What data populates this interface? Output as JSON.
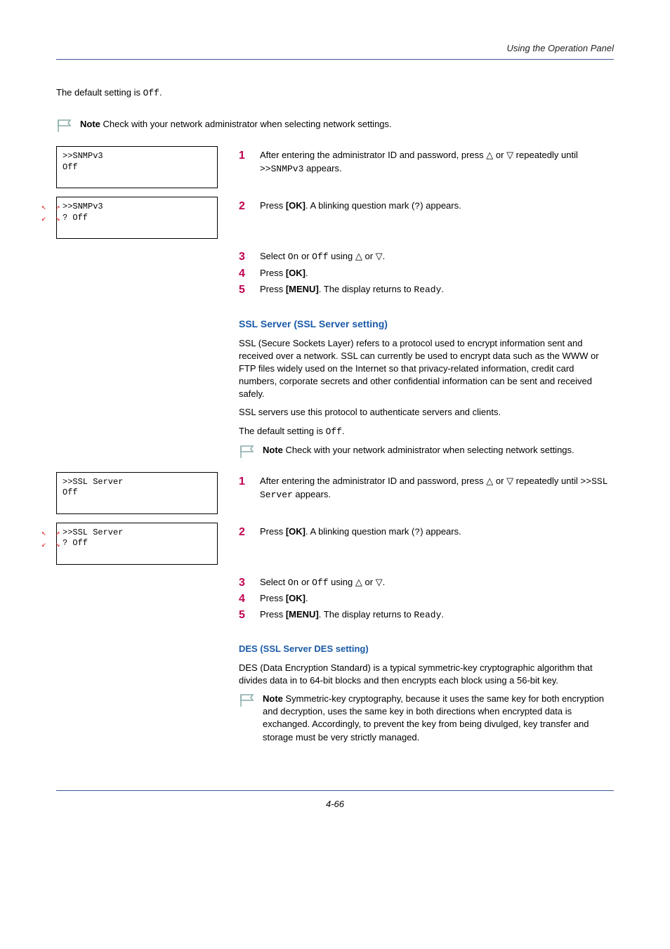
{
  "header": {
    "title": "Using the Operation Panel"
  },
  "intro": {
    "default_text": "The default setting is "
  },
  "notes": {
    "network": "Check with your network administrator when selecting network settings.",
    "symmetric": "Symmetric-key cryptography, because it uses the same key for both encryption and decryption, uses the same key in both directions when encrypted data is exchanged. Accordingly, to prevent the key from being divulged, key transfer and storage must be very strictly managed.",
    "label": "Note"
  },
  "lcd": {
    "snmpv3_line1": ">>SNMPv3",
    "snmpv3_line2": "  Off",
    "snmpv3_q_line1": ">>SNMPv3",
    "snmpv3_q_line2": "? Off",
    "ssl_line1": ">>SSL Server",
    "ssl_line2": "  Off",
    "ssl_q_line1": ">>SSL Server",
    "ssl_q_line2": "? Off"
  },
  "steps_a": {
    "s1a": "After entering the administrator ID and password, press ",
    "s1b": " or ",
    "s1c": " repeatedly until ",
    "s1d": " appears.",
    "s2a": "Press ",
    "s2b": ". A blinking question mark (",
    "s2c": ") appears.",
    "s3a": "Select ",
    "s3b": " or ",
    "s3c": " using ",
    "s3d": " or ",
    "s3e": ".",
    "s4a": "Press ",
    "s4b": ".",
    "s5a": "Press ",
    "s5b": ". The display returns to ",
    "s5c": "."
  },
  "keys": {
    "ok": "[OK]",
    "menu": "[MENU]"
  },
  "values": {
    "on": "On",
    "off": "Off",
    "ready": "Ready",
    "snmpv3_token": ">>SNMPv3",
    "ssl_token": ">>SSL Server",
    "qmark": "?",
    "off_val": "Off"
  },
  "ssl": {
    "heading": "SSL Server (SSL Server setting)",
    "para1": "SSL (Secure Sockets Layer) refers to a protocol used to encrypt information sent and received over a network. SSL can currently be used to encrypt data such as the WWW or FTP files widely used on the Internet so that privacy-related information, credit card numbers, corporate secrets and other confidential information can be sent and received safely.",
    "para2": "SSL servers use this protocol to authenticate servers and clients.",
    "default_text": "The default setting is "
  },
  "des": {
    "heading": "DES (SSL Server DES setting)",
    "para": "DES (Data Encryption Standard) is a typical symmetric-key cryptographic algorithm that divides data in to 64-bit blocks and then encrypts each block using a 56-bit key."
  },
  "footer": {
    "page": "4-66"
  }
}
